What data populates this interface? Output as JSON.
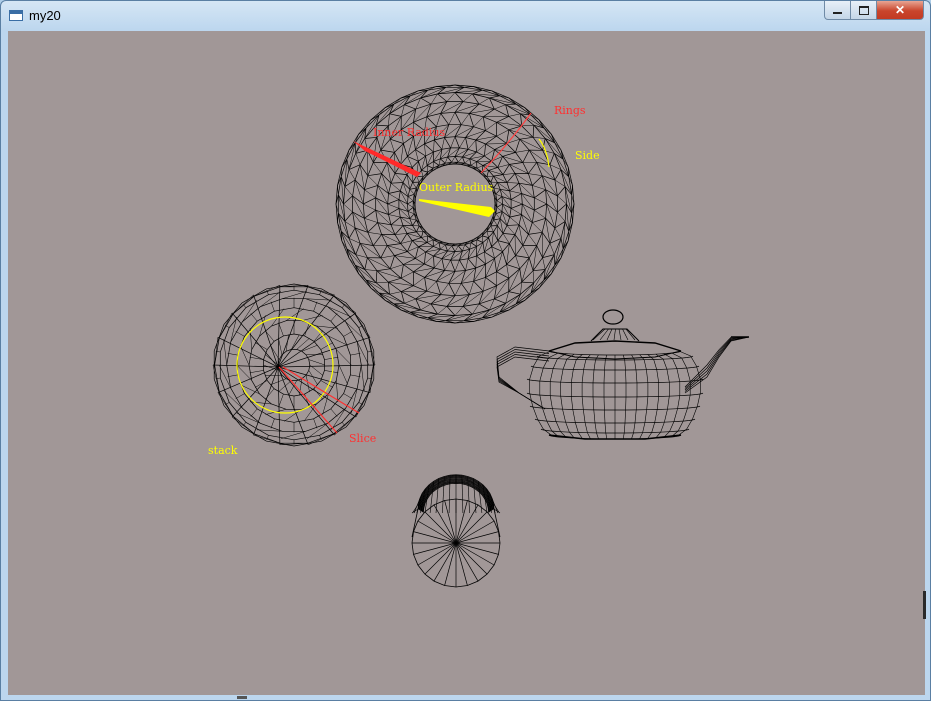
{
  "window": {
    "title": "my20"
  },
  "labels": {
    "inner_radius": "Inner Radius",
    "outer_radius": "Outer Radius",
    "rings": "Rings",
    "side": "Side",
    "stack": "stack",
    "slice": "Slice"
  },
  "icons": {
    "app": "window-icon",
    "minimize": "minimize-icon",
    "maximize": "maximize-icon",
    "close": "close-icon"
  },
  "colors": {
    "background": "#a19797",
    "wire": "#000000",
    "label_red": "#ff3030",
    "label_yellow": "#ffff00"
  }
}
